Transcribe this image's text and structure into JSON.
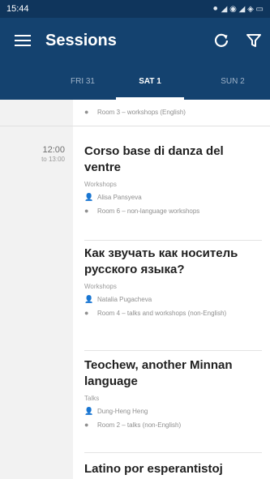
{
  "status_bar": {
    "time": "15:44",
    "icons": [
      "signal-icon",
      "battery-icon"
    ],
    "indicator_text": "⚫ ◢ ◉ ◢ ◈ ▭"
  },
  "app_bar": {
    "title": "Sessions",
    "refresh_icon": "refresh-icon",
    "filter_icon": "filter-icon"
  },
  "tabs": {
    "items": [
      {
        "label": "FRI 31",
        "active": false
      },
      {
        "label": "SAT 1",
        "active": true
      },
      {
        "label": "SUN 2",
        "active": false
      }
    ]
  },
  "sessions": [
    {
      "title": "",
      "type": "",
      "speaker": "",
      "location": "Room 3 – workshops (English)"
    },
    {
      "time_start": "12:00",
      "time_end": "to 13:00",
      "title": "Corso base di danza del ventre",
      "type": "Workshops",
      "speaker": "Alisa Pansyeva",
      "location": "Room 6 – non-language workshops"
    },
    {
      "title": "Как звучать как носитель русского языка?",
      "type": "Workshops",
      "speaker": "Natalia Pugacheva",
      "location": "Room 4 – talks and workshops (non-English)"
    },
    {
      "title": "Teochew, another Minnan language",
      "type": "Talks",
      "speaker": "Dung-Heng Heng",
      "location": "Room 2 – talks (non-English)"
    },
    {
      "title": "Latino por esperantistoj",
      "type": "",
      "speaker": "",
      "location": ""
    }
  ]
}
